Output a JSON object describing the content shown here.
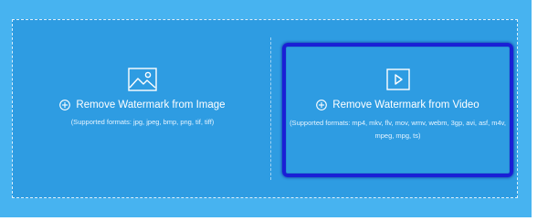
{
  "upload": {
    "image_option": {
      "icon": "image-icon",
      "add_icon": "plus-circle-icon",
      "label": "Remove Watermark from Image",
      "formats": "(Supported formats: jpg, jpeg, bmp, png, tif, tiff)"
    },
    "video_option": {
      "icon": "play-icon",
      "add_icon": "plus-circle-icon",
      "label": "Remove Watermark from Video",
      "formats": "(Supported formats: mp4, mkv, flv, mov, wmv, webm, 3gp, avi, asf, m4v, mpeg, mpg, ts)",
      "highlighted": true
    }
  },
  "colors": {
    "background": "#2e9ce2",
    "outer_frame": "#47b3f0",
    "highlight_border": "#1a1fd6",
    "text": "#ffffff"
  }
}
